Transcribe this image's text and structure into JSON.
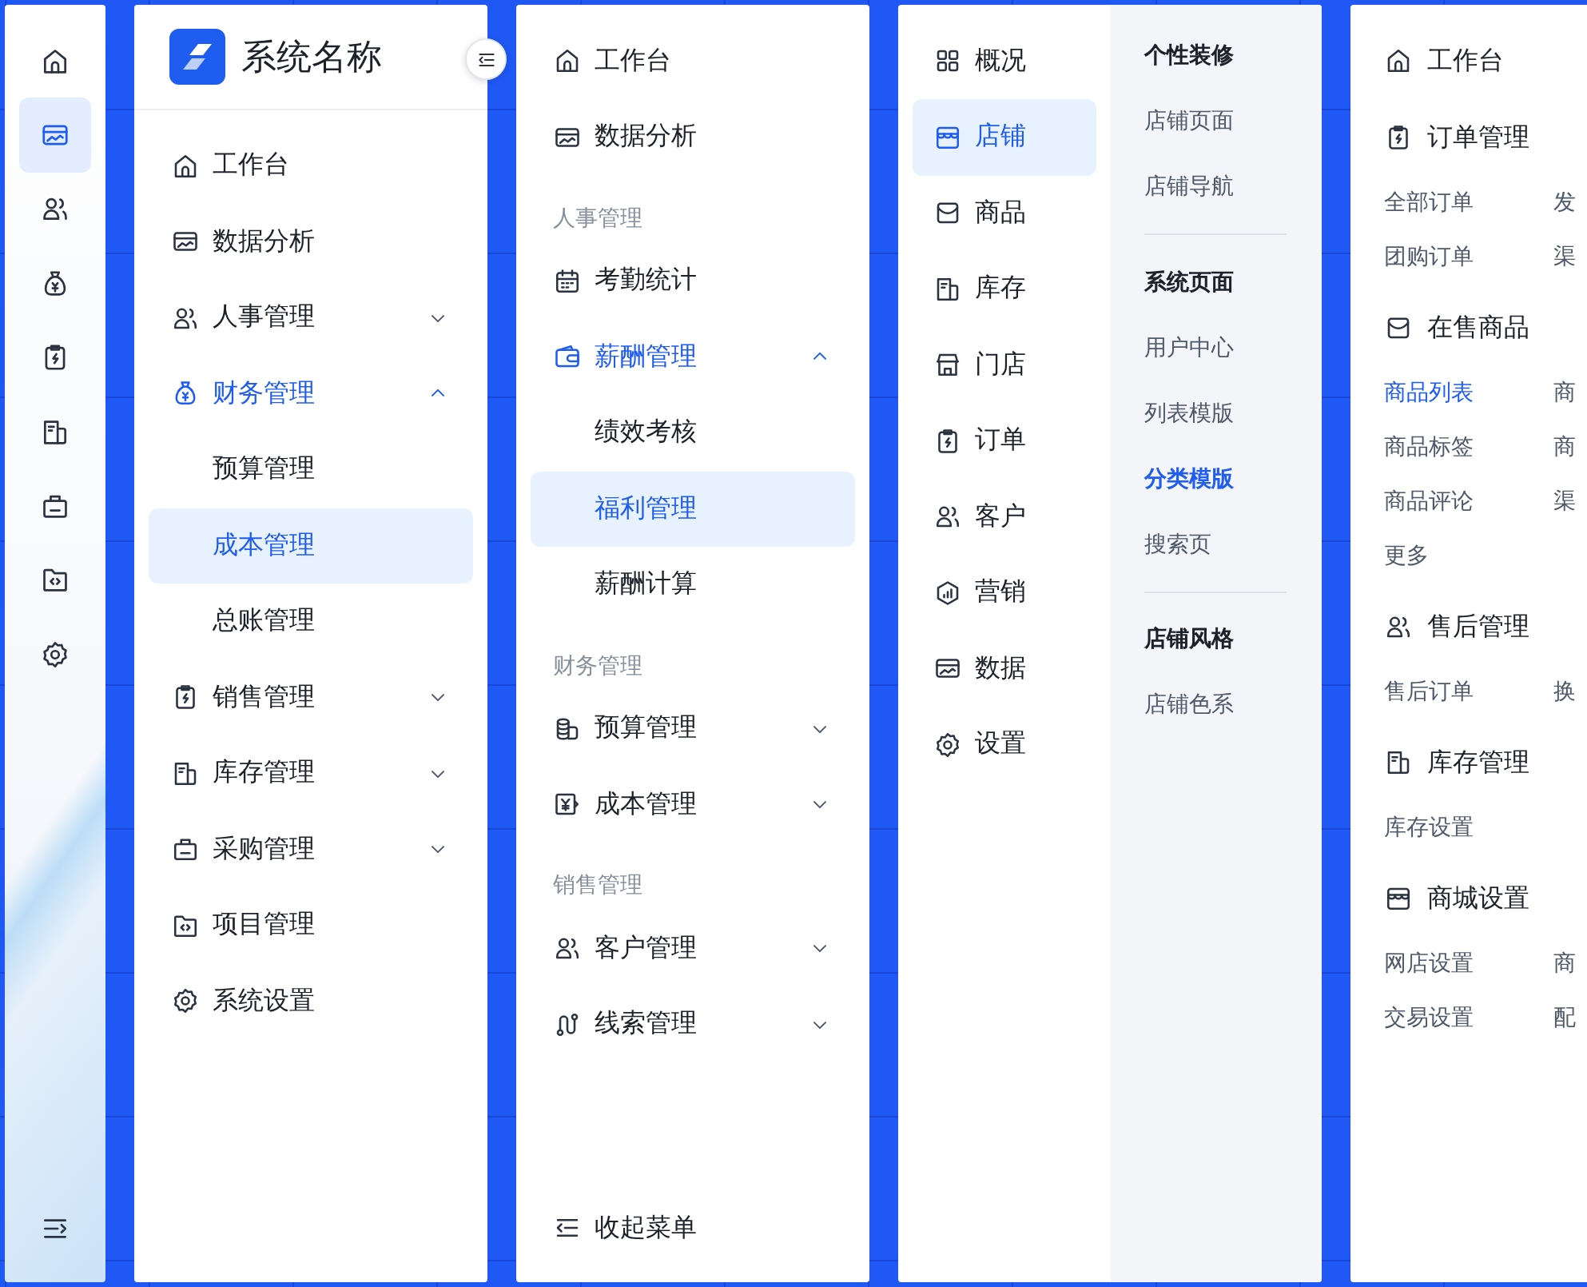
{
  "icon_rail": {
    "items": [
      {
        "selected": false
      },
      {
        "selected": true
      },
      {
        "selected": false
      },
      {
        "selected": false
      },
      {
        "selected": false
      },
      {
        "selected": false
      },
      {
        "selected": false
      },
      {
        "selected": false
      },
      {
        "selected": false
      }
    ]
  },
  "sidebar": {
    "title": "系统名称",
    "items": [
      {
        "kind": "item",
        "label": "工作台",
        "selected": false
      },
      {
        "kind": "item",
        "label": "数据分析",
        "selected": false
      },
      {
        "kind": "group",
        "label": "人事管理",
        "selected": false,
        "expanded": false
      },
      {
        "kind": "group",
        "label": "财务管理",
        "selected": true,
        "expanded": true,
        "children": [
          {
            "label": "预算管理",
            "selected": false
          },
          {
            "label": "成本管理",
            "selected": true
          },
          {
            "label": "总账管理",
            "selected": false
          }
        ]
      },
      {
        "kind": "group",
        "label": "销售管理",
        "selected": false,
        "expanded": false
      },
      {
        "kind": "group",
        "label": "库存管理",
        "selected": false,
        "expanded": false
      },
      {
        "kind": "group",
        "label": "采购管理",
        "selected": false,
        "expanded": false
      },
      {
        "kind": "item",
        "label": "项目管理",
        "selected": false
      },
      {
        "kind": "item",
        "label": "系统设置",
        "selected": false
      }
    ]
  },
  "grouped_sidebar": {
    "items": [
      {
        "kind": "item",
        "label": "工作台",
        "selected": false
      },
      {
        "kind": "item",
        "label": "数据分析",
        "selected": false
      },
      {
        "kind": "section",
        "label": "人事管理"
      },
      {
        "kind": "item",
        "label": "考勤统计",
        "selected": false
      },
      {
        "kind": "group",
        "label": "薪酬管理",
        "selected": true,
        "expanded": true,
        "children": [
          {
            "label": "绩效考核",
            "selected": false
          },
          {
            "label": "福利管理",
            "selected": true
          },
          {
            "label": "薪酬计算",
            "selected": false
          }
        ]
      },
      {
        "kind": "section",
        "label": "财务管理"
      },
      {
        "kind": "group",
        "label": "预算管理",
        "selected": false,
        "expanded": false
      },
      {
        "kind": "group",
        "label": "成本管理",
        "selected": false,
        "expanded": false
      },
      {
        "kind": "section",
        "label": "销售管理"
      },
      {
        "kind": "group",
        "label": "客户管理",
        "selected": false,
        "expanded": false
      },
      {
        "kind": "group",
        "label": "线索管理",
        "selected": false,
        "expanded": false
      }
    ],
    "collapse_label": "收起菜单"
  },
  "nav_menu": {
    "items": [
      {
        "label": "概况",
        "selected": false
      },
      {
        "label": "店铺",
        "selected": true
      },
      {
        "label": "商品",
        "selected": false
      },
      {
        "label": "库存",
        "selected": false
      },
      {
        "label": "门店",
        "selected": false
      },
      {
        "label": "订单",
        "selected": false
      },
      {
        "label": "客户",
        "selected": false
      },
      {
        "label": "营销",
        "selected": false
      },
      {
        "label": "数据",
        "selected": false
      },
      {
        "label": "设置",
        "selected": false
      }
    ],
    "flyout": {
      "sections": [
        {
          "title": "个性装修",
          "links": [
            {
              "label": "店铺页面",
              "selected": false
            },
            {
              "label": "店铺导航",
              "selected": false
            }
          ]
        },
        {
          "title": "系统页面",
          "links": [
            {
              "label": "用户中心",
              "selected": false
            },
            {
              "label": "列表模版",
              "selected": false
            },
            {
              "label": "分类模版",
              "selected": true
            },
            {
              "label": "搜索页",
              "selected": false
            }
          ]
        },
        {
          "title": "店铺风格",
          "links": [
            {
              "label": "店铺色系",
              "selected": false
            }
          ]
        }
      ]
    }
  },
  "mega_menu": {
    "sections": [
      {
        "title": "工作台"
      },
      {
        "title": "订单管理",
        "links": [
          {
            "label": "全部订单",
            "selected": false
          },
          {
            "label": "发",
            "selected": false
          },
          {
            "label": "团购订单",
            "selected": false
          },
          {
            "label": "渠",
            "selected": false
          }
        ]
      },
      {
        "title": "在售商品",
        "links": [
          {
            "label": "商品列表",
            "selected": true
          },
          {
            "label": "商",
            "selected": false
          },
          {
            "label": "商品标签",
            "selected": false
          },
          {
            "label": "商",
            "selected": false
          },
          {
            "label": "商品评论",
            "selected": false
          },
          {
            "label": "渠",
            "selected": false
          },
          {
            "label": "更多",
            "selected": false
          }
        ]
      },
      {
        "title": "售后管理",
        "links": [
          {
            "label": "售后订单",
            "selected": false
          },
          {
            "label": "换",
            "selected": false
          }
        ]
      },
      {
        "title": "库存管理",
        "links": [
          {
            "label": "库存设置",
            "selected": false
          }
        ]
      },
      {
        "title": "商城设置",
        "links": [
          {
            "label": "网店设置",
            "selected": false
          },
          {
            "label": "商",
            "selected": false
          },
          {
            "label": "交易设置",
            "selected": false
          },
          {
            "label": "配",
            "selected": false
          }
        ]
      }
    ]
  }
}
